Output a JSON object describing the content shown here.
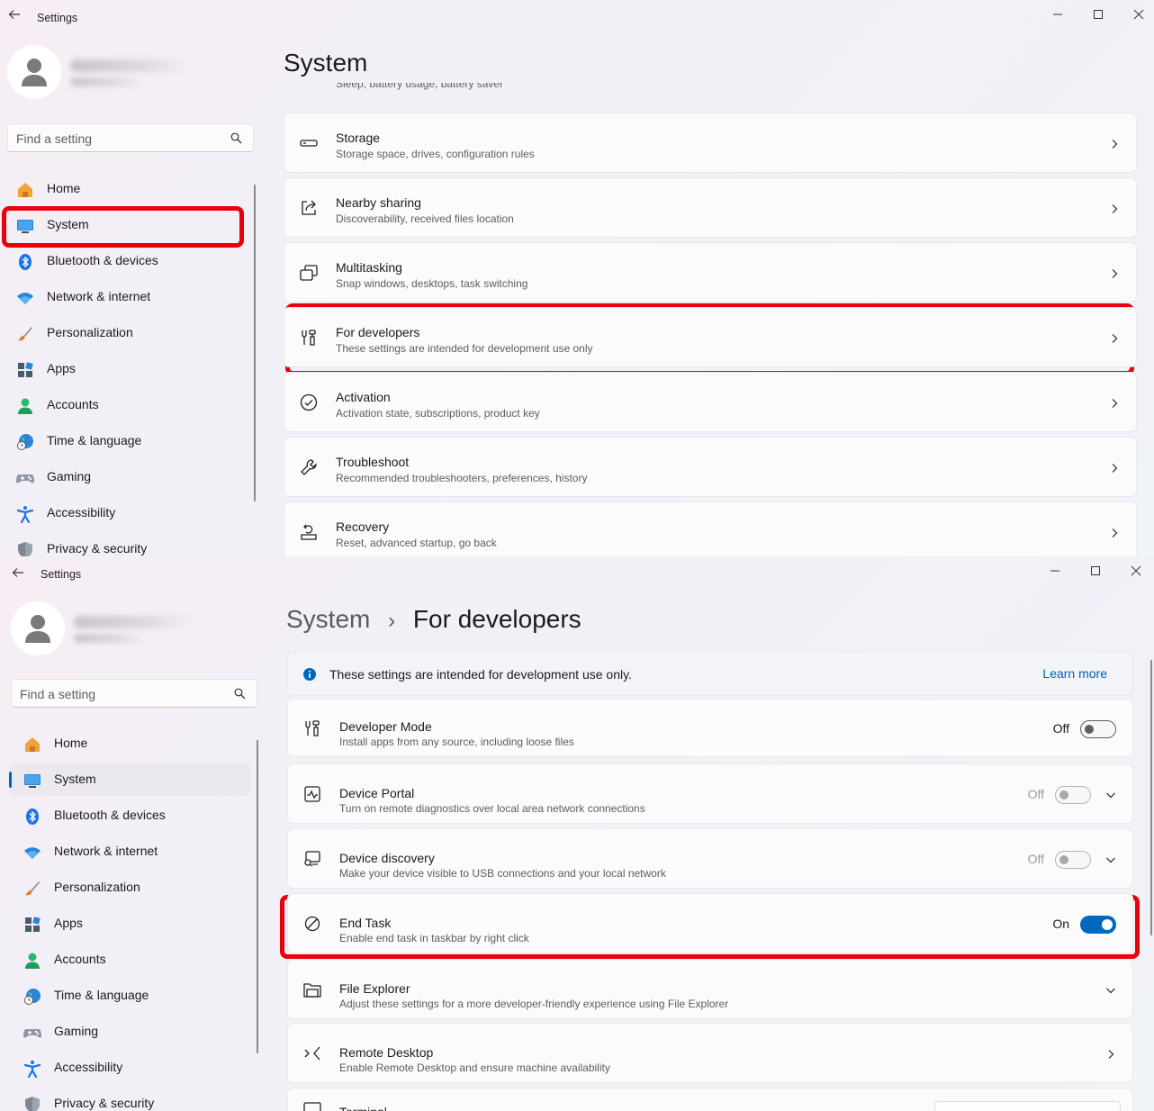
{
  "window1": {
    "title": "Settings",
    "search_placeholder": "Find a setting",
    "page_title": "System",
    "clipped_text": "Sleep, battery usage, battery saver",
    "nav": [
      {
        "label": "Home",
        "icon": "home-icon"
      },
      {
        "label": "System",
        "icon": "monitor-icon",
        "active": false
      },
      {
        "label": "Bluetooth & devices",
        "icon": "bluetooth-icon"
      },
      {
        "label": "Network & internet",
        "icon": "wifi-icon"
      },
      {
        "label": "Personalization",
        "icon": "brush-icon"
      },
      {
        "label": "Apps",
        "icon": "apps-icon"
      },
      {
        "label": "Accounts",
        "icon": "accounts-icon"
      },
      {
        "label": "Time & language",
        "icon": "globe-icon"
      },
      {
        "label": "Gaming",
        "icon": "gamepad-icon"
      },
      {
        "label": "Accessibility",
        "icon": "accessibility-icon"
      },
      {
        "label": "Privacy & security",
        "icon": "shield-icon"
      }
    ],
    "cards": [
      {
        "title": "Storage",
        "subtitle": "Storage space, drives, configuration rules",
        "icon": "storage-icon"
      },
      {
        "title": "Nearby sharing",
        "subtitle": "Discoverability, received files location",
        "icon": "share-icon"
      },
      {
        "title": "Multitasking",
        "subtitle": "Snap windows, desktops, task switching",
        "icon": "multitasking-icon"
      },
      {
        "title": "For developers",
        "subtitle": "These settings are intended for development use only",
        "icon": "developer-tools-icon"
      },
      {
        "title": "Activation",
        "subtitle": "Activation state, subscriptions, product key",
        "icon": "check-circle-icon"
      },
      {
        "title": "Troubleshoot",
        "subtitle": "Recommended troubleshooters, preferences, history",
        "icon": "wrench-icon"
      },
      {
        "title": "Recovery",
        "subtitle": "Reset, advanced startup, go back",
        "icon": "recovery-icon"
      }
    ]
  },
  "window2": {
    "title": "Settings",
    "search_placeholder": "Find a setting",
    "breadcrumb_parent": "System",
    "breadcrumb_separator": "›",
    "page_title": "For developers",
    "info_text": "These settings are intended for development use only.",
    "learn_more": "Learn more",
    "nav": [
      {
        "label": "Home",
        "icon": "home-icon"
      },
      {
        "label": "System",
        "icon": "monitor-icon",
        "active": true
      },
      {
        "label": "Bluetooth & devices",
        "icon": "bluetooth-icon"
      },
      {
        "label": "Network & internet",
        "icon": "wifi-icon"
      },
      {
        "label": "Personalization",
        "icon": "brush-icon"
      },
      {
        "label": "Apps",
        "icon": "apps-icon"
      },
      {
        "label": "Accounts",
        "icon": "accounts-icon"
      },
      {
        "label": "Time & language",
        "icon": "globe-icon"
      },
      {
        "label": "Gaming",
        "icon": "gamepad-icon"
      },
      {
        "label": "Accessibility",
        "icon": "accessibility-icon"
      },
      {
        "label": "Privacy & security",
        "icon": "shield-icon"
      }
    ],
    "cards": [
      {
        "title": "Developer Mode",
        "subtitle": "Install apps from any source, including loose files",
        "state": "Off",
        "icon": "developer-tools-icon"
      },
      {
        "title": "Device Portal",
        "subtitle": "Turn on remote diagnostics over local area network connections",
        "state": "Off",
        "icon": "device-portal-icon"
      },
      {
        "title": "Device discovery",
        "subtitle": "Make your device visible to USB connections and your local network",
        "state": "Off",
        "icon": "device-discovery-icon"
      },
      {
        "title": "End Task",
        "subtitle": "Enable end task in taskbar by right click",
        "state": "On",
        "icon": "end-task-icon"
      },
      {
        "title": "File Explorer",
        "subtitle": "Adjust these settings for a more developer-friendly experience using File Explorer",
        "icon": "folder-icon"
      },
      {
        "title": "Remote Desktop",
        "subtitle": "Enable Remote Desktop and ensure machine availability",
        "icon": "remote-desktop-icon"
      },
      {
        "title": "Terminal",
        "icon": "terminal-icon"
      }
    ]
  },
  "colors": {
    "accent": "#0067c0",
    "highlight": "#e8000b"
  }
}
